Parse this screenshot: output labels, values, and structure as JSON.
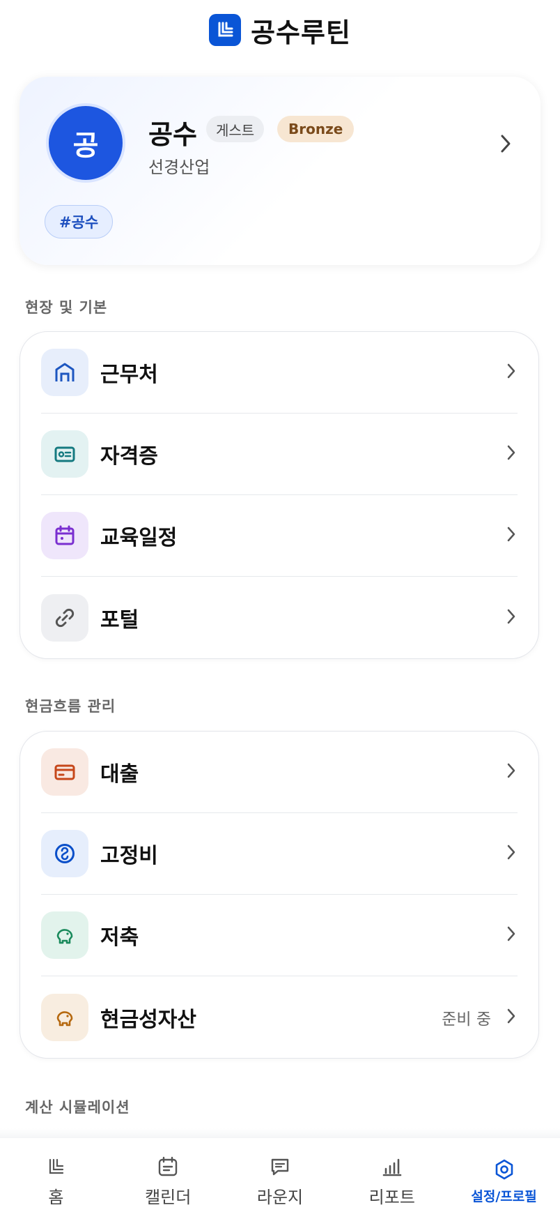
{
  "header": {
    "title": "공수루틴"
  },
  "profile": {
    "avatar_text": "공",
    "name": "공수",
    "badge_guest": "게스트",
    "badge_tier": "Bronze",
    "company": "선경산업",
    "tag": "#공수"
  },
  "sections": [
    {
      "title": "현장 및 기본",
      "items": [
        {
          "label": "근무처",
          "icon": "building-icon"
        },
        {
          "label": "자격증",
          "icon": "id-card-icon"
        },
        {
          "label": "교육일정",
          "icon": "calendar-icon"
        },
        {
          "label": "포털",
          "icon": "link-icon"
        }
      ]
    },
    {
      "title": "현금흐름 관리",
      "items": [
        {
          "label": "대출",
          "icon": "credit-card-icon"
        },
        {
          "label": "고정비",
          "icon": "coin-icon"
        },
        {
          "label": "저축",
          "icon": "piggy-bank-icon"
        },
        {
          "label": "현금성자산",
          "icon": "piggy-bank-icon",
          "status": "준비 중"
        }
      ]
    },
    {
      "title": "계산 시뮬레이션"
    }
  ],
  "nav": [
    {
      "label": "홈",
      "icon": "home-logo-icon"
    },
    {
      "label": "캘린더",
      "icon": "calendar-icon"
    },
    {
      "label": "라운지",
      "icon": "chat-icon"
    },
    {
      "label": "리포트",
      "icon": "bar-chart-icon"
    },
    {
      "label": "설정/프로필",
      "icon": "settings-icon",
      "active": true
    }
  ],
  "colors": {
    "accent": "#0a55d6",
    "avatar": "#1d56e0",
    "bronze_bg": "#f7e6d2",
    "bronze_text": "#7a4a1a"
  }
}
